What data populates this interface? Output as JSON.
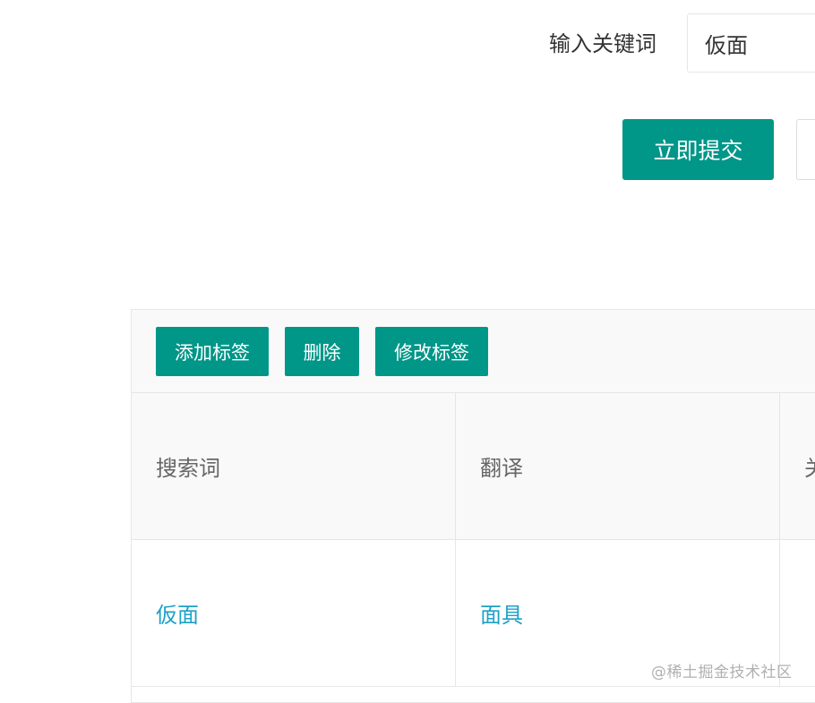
{
  "search": {
    "label": "输入关键词",
    "value": "仮面"
  },
  "actions": {
    "submit_label": "立即提交"
  },
  "toolbar": {
    "add_label": "添加标签",
    "delete_label": "删除",
    "edit_label": "修改标签"
  },
  "table": {
    "columns": [
      "搜索词",
      "翻译",
      "关"
    ],
    "rows": [
      {
        "term": "仮面",
        "translation": "面具"
      }
    ]
  },
  "watermark": "@稀土掘金技术社区",
  "colors": {
    "accent": "#009688",
    "link": "#1da1c8",
    "header_bg": "#f9f9f9",
    "border": "#e6e6e6"
  }
}
